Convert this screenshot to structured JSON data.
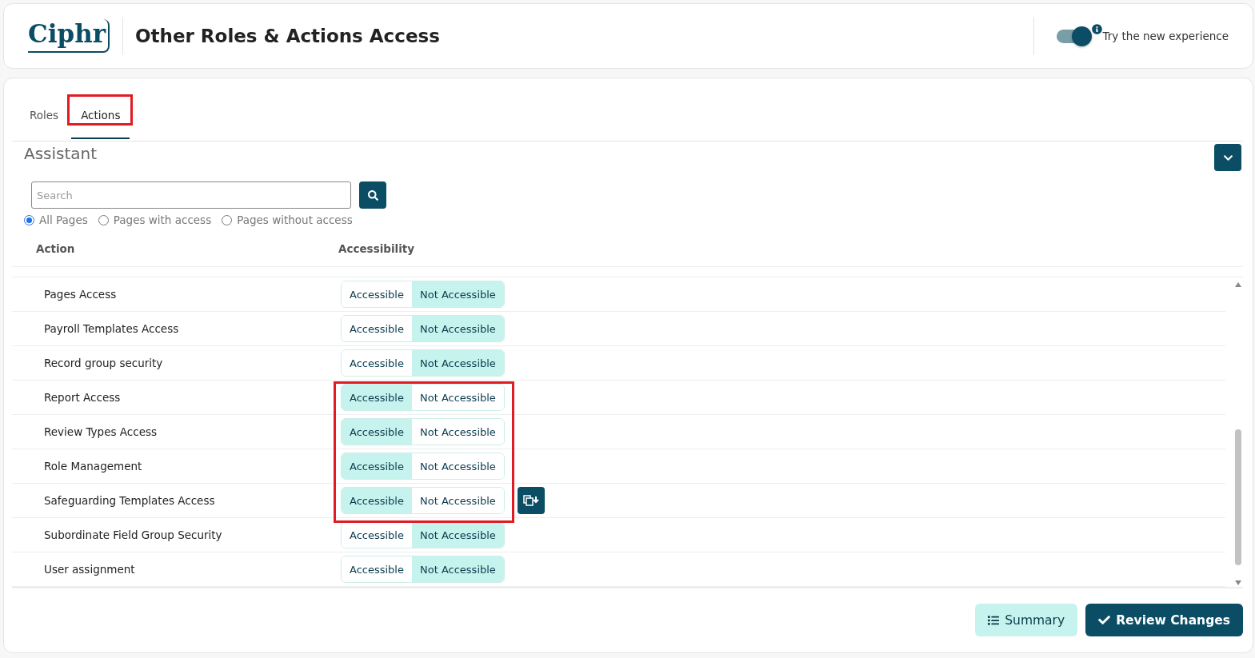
{
  "header": {
    "logo": "Ciphr",
    "title": "Other Roles & Actions Access",
    "toggle": {
      "label": "Try the new experience",
      "on": true
    }
  },
  "tabs": [
    {
      "label": "Roles",
      "selected": false,
      "highlighted": false
    },
    {
      "label": "Actions",
      "selected": true,
      "highlighted": true
    }
  ],
  "section": {
    "title": "Assistant"
  },
  "search": {
    "placeholder": "Search"
  },
  "filters": [
    {
      "label": "All Pages",
      "selected": true
    },
    {
      "label": "Pages with access",
      "selected": false
    },
    {
      "label": "Pages without access",
      "selected": false
    }
  ],
  "table": {
    "columns": [
      "Action",
      "Accessibility"
    ],
    "rows": [
      {
        "action": "Pages Access",
        "options": [
          {
            "label": "Accessible",
            "selected": false
          },
          {
            "label": "Not Accessible",
            "selected": true
          }
        ],
        "highlighted": false,
        "copy_button": false
      },
      {
        "action": "Payroll Templates Access",
        "options": [
          {
            "label": "Accessible",
            "selected": false
          },
          {
            "label": "Not Accessible",
            "selected": true
          }
        ],
        "highlighted": false,
        "copy_button": false
      },
      {
        "action": "Record group security",
        "options": [
          {
            "label": "Accessible",
            "selected": false
          },
          {
            "label": "Not Accessible",
            "selected": true
          }
        ],
        "highlighted": false,
        "copy_button": false
      },
      {
        "action": "Report Access",
        "options": [
          {
            "label": "Accessible",
            "selected": true
          },
          {
            "label": "Not Accessible",
            "selected": false
          }
        ],
        "highlighted": true,
        "copy_button": false
      },
      {
        "action": "Review Types Access",
        "options": [
          {
            "label": "Accessible",
            "selected": true
          },
          {
            "label": "Not Accessible",
            "selected": false
          }
        ],
        "highlighted": true,
        "copy_button": false
      },
      {
        "action": "Role Management",
        "options": [
          {
            "label": "Accessible",
            "selected": true
          },
          {
            "label": "Not Accessible",
            "selected": false
          }
        ],
        "highlighted": true,
        "copy_button": false
      },
      {
        "action": "Safeguarding Templates Access",
        "options": [
          {
            "label": "Accessible",
            "selected": true
          },
          {
            "label": "Not Accessible",
            "selected": false
          }
        ],
        "highlighted": true,
        "copy_button": true
      },
      {
        "action": "Subordinate Field Group Security",
        "options": [
          {
            "label": "Accessible",
            "selected": false
          },
          {
            "label": "Not Accessible",
            "selected": true
          }
        ],
        "highlighted": false,
        "copy_button": false
      },
      {
        "action": "User assignment",
        "options": [
          {
            "label": "Accessible",
            "selected": false
          },
          {
            "label": "Not Accessible",
            "selected": true
          }
        ],
        "highlighted": false,
        "copy_button": false
      }
    ]
  },
  "buttons": [
    {
      "label": "Summary",
      "kind": "secondary"
    },
    {
      "label": "Review Changes",
      "kind": "primary"
    }
  ]
}
